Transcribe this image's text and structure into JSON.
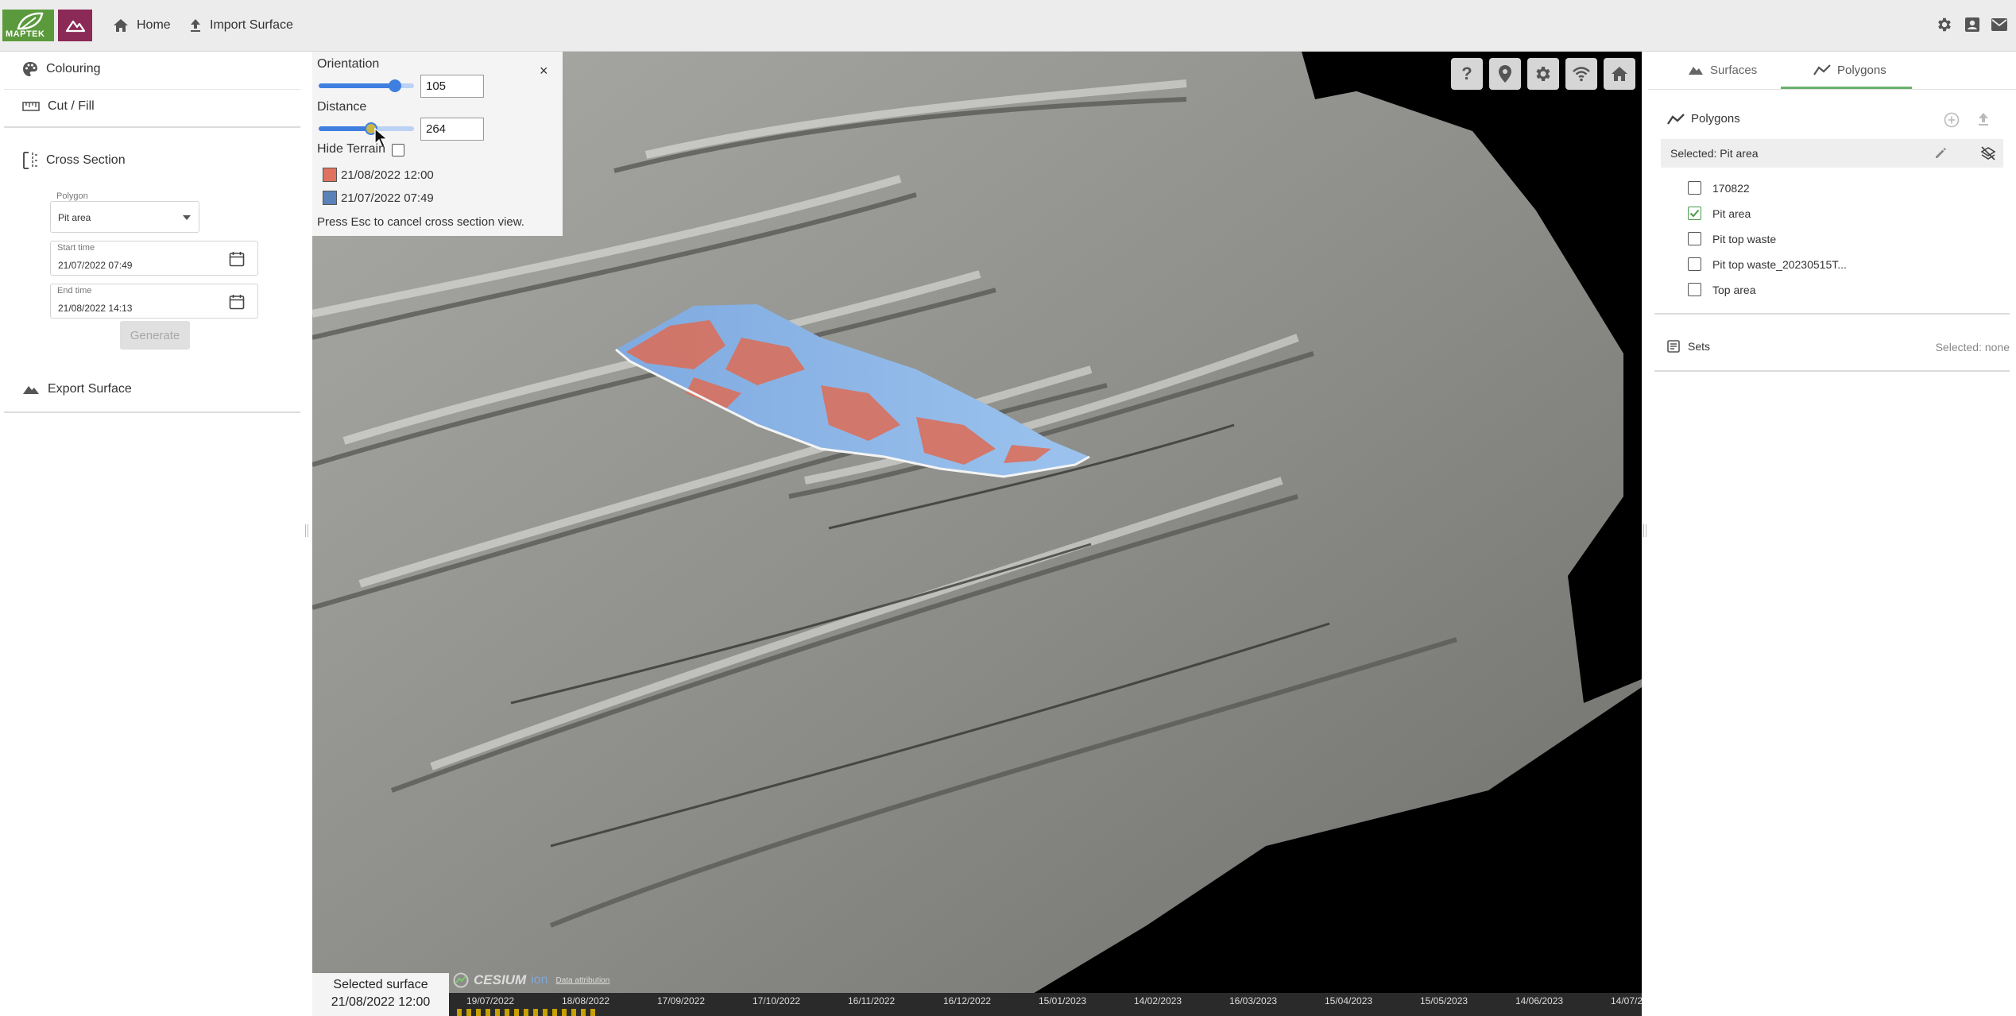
{
  "topbar": {
    "logo_text": "MAPTEK",
    "nav": [
      {
        "label": "Home",
        "icon": "home-icon"
      },
      {
        "label": "Import Surface",
        "icon": "upload-icon"
      }
    ],
    "right_icons": [
      "gear-icon",
      "contact-card-icon",
      "mail-icon"
    ]
  },
  "left_panel": {
    "colouring_label": "Colouring",
    "cut_fill_label": "Cut / Fill",
    "cross_section": {
      "title": "Cross Section",
      "polygon_label": "Polygon",
      "polygon_value": "Pit area",
      "start_time_label": "Start time",
      "start_time_value": "21/07/2022 07:49",
      "end_time_label": "End time",
      "end_time_value": "21/08/2022 14:13",
      "generate_label": "Generate"
    },
    "export_label": "Export Surface"
  },
  "cross_section_popup": {
    "orientation_label": "Orientation",
    "orientation_value": "105",
    "orientation_fraction": 0.8,
    "distance_label": "Distance",
    "distance_value": "264",
    "distance_fraction": 0.55,
    "hide_terrain_label": "Hide Terrain",
    "close_label": "×",
    "legend": [
      {
        "label": "21/08/2022 12:00",
        "color": "#e0735f"
      },
      {
        "label": "21/07/2022 07:49",
        "color": "#5b82b8"
      }
    ],
    "hint": "Press Esc to cancel cross section view."
  },
  "viewport_toolbar": [
    "help-icon",
    "location-pin-icon",
    "gear-icon",
    "wifi-icon",
    "home-icon"
  ],
  "right_panel": {
    "tabs": [
      {
        "label": "Surfaces",
        "icon": "mountain-icon",
        "active": false
      },
      {
        "label": "Polygons",
        "icon": "polyline-icon",
        "active": true
      }
    ],
    "polygons_title": "Polygons",
    "selected_label": "Selected: Pit area",
    "items": [
      {
        "label": "170822",
        "checked": false
      },
      {
        "label": "Pit area",
        "checked": true
      },
      {
        "label": "Pit top waste",
        "checked": false
      },
      {
        "label": "Pit top waste_20230515T...",
        "checked": false
      },
      {
        "label": "Top area",
        "checked": false
      }
    ],
    "sets_title": "Sets",
    "sets_selected": "Selected: none"
  },
  "bottom": {
    "selected_surface_label": "Selected surface",
    "selected_surface_value": "21/08/2022 12:00",
    "cesium_label": "CESIUM",
    "cesium_ion": "ion",
    "data_attribution": "Data attribution",
    "timeline_ticks": [
      "19/07/2022",
      "18/08/2022",
      "17/09/2022",
      "17/10/2022",
      "16/11/2022",
      "16/12/2022",
      "15/01/2023",
      "14/02/2023",
      "16/03/2023",
      "15/04/2023",
      "15/05/2023",
      "14/06/2023",
      "14/07/2"
    ]
  },
  "colors": {
    "accent_blue": "#3f7fe0",
    "green_check": "#4a9a4a",
    "maptek_green": "#5b9a3c",
    "app_purple": "#8b2a57"
  }
}
